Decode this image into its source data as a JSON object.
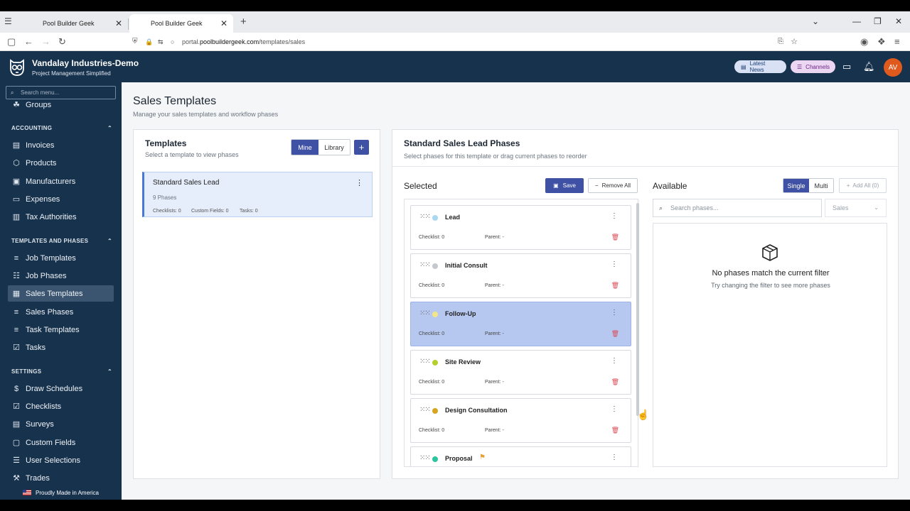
{
  "browser": {
    "tabs": [
      {
        "label": "Pool Builder Geek",
        "active": false
      },
      {
        "label": "Pool Builder Geek",
        "active": true
      }
    ],
    "url_prefix": "portal.",
    "url_domain": "poolbuildergeek.com",
    "url_path": "/templates/sales"
  },
  "header": {
    "company": "Vandalay Industries-Demo",
    "tagline": "Project Management Simplified",
    "latest_news": "Latest News",
    "channels": "Channels",
    "avatar_initials": "AV"
  },
  "sidebar": {
    "search_placeholder": "Search menu...",
    "groups_item": "Groups",
    "accounting_heading": "ACCOUNTING",
    "accounting": [
      "Invoices",
      "Products",
      "Manufacturers",
      "Expenses",
      "Tax Authorities"
    ],
    "templates_heading": "TEMPLATES AND PHASES",
    "templates": [
      "Job Templates",
      "Job Phases",
      "Sales Templates",
      "Sales Phases",
      "Task Templates",
      "Tasks"
    ],
    "settings_heading": "SETTINGS",
    "settings": [
      "Draw Schedules",
      "Checklists",
      "Surveys",
      "Custom Fields",
      "User Selections",
      "Trades"
    ],
    "footer": "Proudly Made in America"
  },
  "page": {
    "title": "Sales Templates",
    "subtitle": "Manage your sales templates and workflow phases"
  },
  "templates_panel": {
    "title": "Templates",
    "subtitle": "Select a template to view phases",
    "mine": "Mine",
    "library": "Library",
    "add": "+",
    "card": {
      "name": "Standard Sales Lead",
      "phases": "9 Phases",
      "checklists": "Checklists: 0",
      "custom_fields": "Custom Fields: 0",
      "tasks": "Tasks: 0"
    }
  },
  "phases_panel": {
    "title": "Standard Sales Lead Phases",
    "subtitle": "Select phases for this template or drag current phases to reorder",
    "selected_label": "Selected",
    "save": "Save",
    "remove_all": "Remove All",
    "phases": [
      {
        "name": "Lead",
        "color": "#a9d8f0",
        "checklist": "Checklist: 0",
        "parent": "Parent: -"
      },
      {
        "name": "Initial Consult",
        "color": "#c5c8cc",
        "checklist": "Checklist: 0",
        "parent": "Parent: -"
      },
      {
        "name": "Follow-Up",
        "color": "#f2e58a",
        "checklist": "Checklist: 0",
        "parent": "Parent: -"
      },
      {
        "name": "Site Review",
        "color": "#b4cf2e",
        "checklist": "Checklist: 0",
        "parent": "Parent: -"
      },
      {
        "name": "Design Consultation",
        "color": "#d6a41f",
        "checklist": "Checklist: 0",
        "parent": "Parent: -"
      },
      {
        "name": "Proposal",
        "color": "#2ec4a0",
        "checklist": "",
        "parent": ""
      }
    ],
    "available_label": "Available",
    "single": "Single",
    "multi": "Multi",
    "add_all": "Add All (0)",
    "search_placeholder": "Search phases...",
    "filter_value": "Sales",
    "empty_title": "No phases match the current filter",
    "empty_sub": "Try changing the filter to see more phases"
  }
}
